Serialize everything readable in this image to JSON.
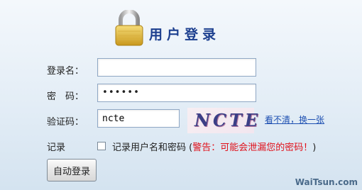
{
  "header": {
    "title": "用户登录"
  },
  "form": {
    "username": {
      "label": "登录名：",
      "value": ""
    },
    "password": {
      "label": "密　码：",
      "value": "••••••"
    },
    "captcha": {
      "label": "验证码：",
      "value": "ncte",
      "image_text": "NCTE",
      "refresh_link": "看不清，换一张"
    },
    "remember": {
      "label": "记录",
      "text_plain": "记录用户名和密码 (",
      "text_warning": "警告：可能会泄漏您的密码！",
      "text_close": ")",
      "checked": false
    },
    "submit_label": "自动登录"
  },
  "watermark": "WaiTsun.com"
}
